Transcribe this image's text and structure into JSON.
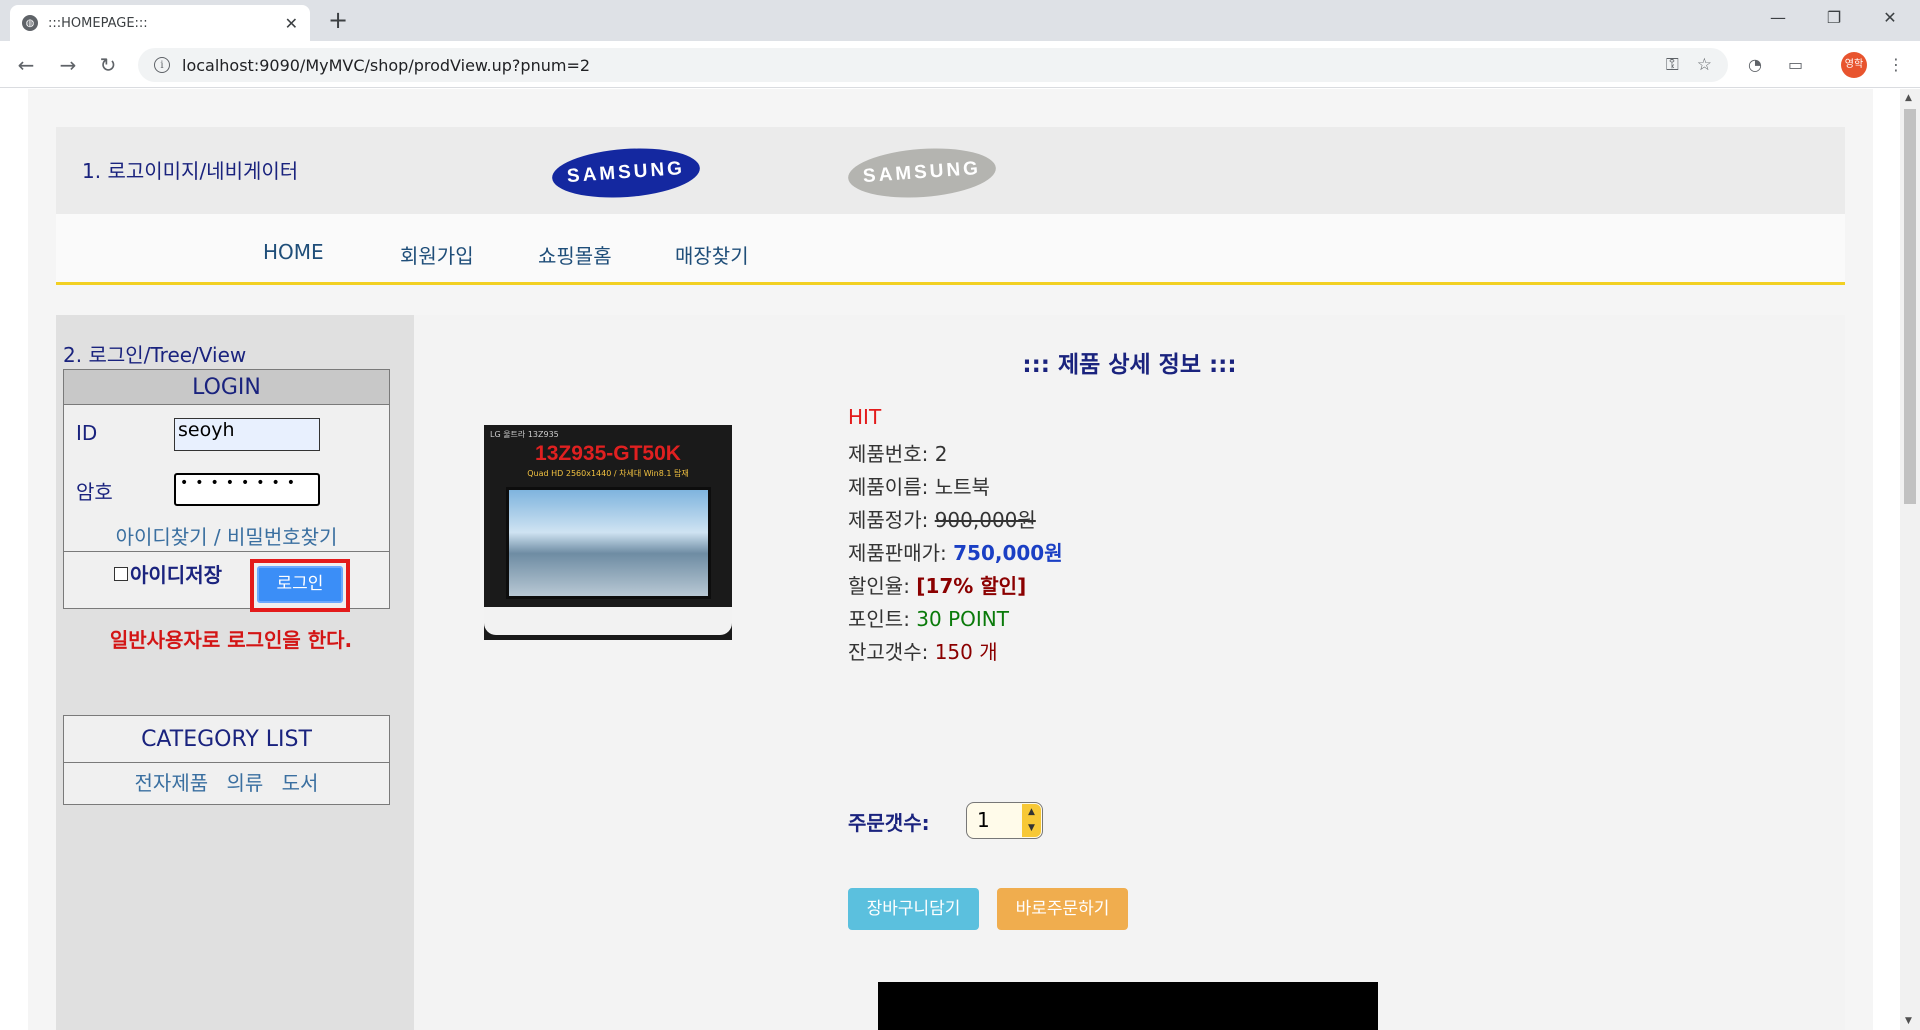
{
  "browser": {
    "tab_title": ":::HOMEPAGE:::",
    "url": "localhost:9090/MyMVC/shop/prodView.up?pnum=2",
    "profile_label": "영학"
  },
  "header": {
    "label": "1. 로고이미지/네비게이터",
    "logo_blue_text": "SAMSUNG",
    "logo_gray_text": "SAMSUNG"
  },
  "topnav": {
    "items": [
      "HOME",
      "회원가입",
      "쇼핑몰홈",
      "매장찾기"
    ]
  },
  "sidebar": {
    "title": "2. 로그인/Tree/View",
    "login": {
      "heading": "LOGIN",
      "id_label": "ID",
      "id_value": "seoyh",
      "pw_label": "암호",
      "pw_value": "••••••••",
      "find_id": "아이디찾기",
      "find_sep": " / ",
      "find_pw": "비밀번호찾기",
      "save_id_label": "아이디저장",
      "login_button": "로그인"
    },
    "login_message": "일반사용자로 로그인을 한다.",
    "category": {
      "heading": "CATEGORY LIST",
      "items": [
        "전자제품",
        "의류",
        "도서"
      ]
    }
  },
  "main": {
    "title": "::: 제품 상세 정보 :::",
    "image": {
      "brand": "LG 울트라 13Z935",
      "model": "13Z935-GT50K",
      "sub": "Quad HD 2560x1440 / 차세대 Win8.1 탑재"
    },
    "spec": "HIT",
    "product_no_label": "제품번호: ",
    "product_no": "2",
    "product_name_label": "제품이름: ",
    "product_name": "노트북",
    "price_label": "제품정가: ",
    "price": "900,000원",
    "sale_price_label": "제품판매가: ",
    "sale_price": "750,000원",
    "discount_label": "할인율: ",
    "discount": "[17% 할인]",
    "point_label": "포인트: ",
    "point": "30 POINT",
    "stock_label": "잔고갯수: ",
    "stock": "150 개",
    "qty_label": "주문갯수:",
    "qty_value": "1",
    "cart_button": "장바구니담기",
    "order_button": "바로주문하기"
  },
  "colors": {
    "accent_yellow": "#f2d022",
    "login_blue": "#3b8ef7",
    "highlight_red": "#e31b1b",
    "cart_button": "#5bc0de",
    "order_button": "#f0ad4e"
  },
  "icons": {
    "tab_favicon": "globe-icon",
    "back": "arrow-left-icon",
    "forward": "arrow-right-icon",
    "reload": "reload-icon",
    "key": "key-icon",
    "bookmark": "star-icon",
    "menu": "kebab-menu-icon"
  }
}
